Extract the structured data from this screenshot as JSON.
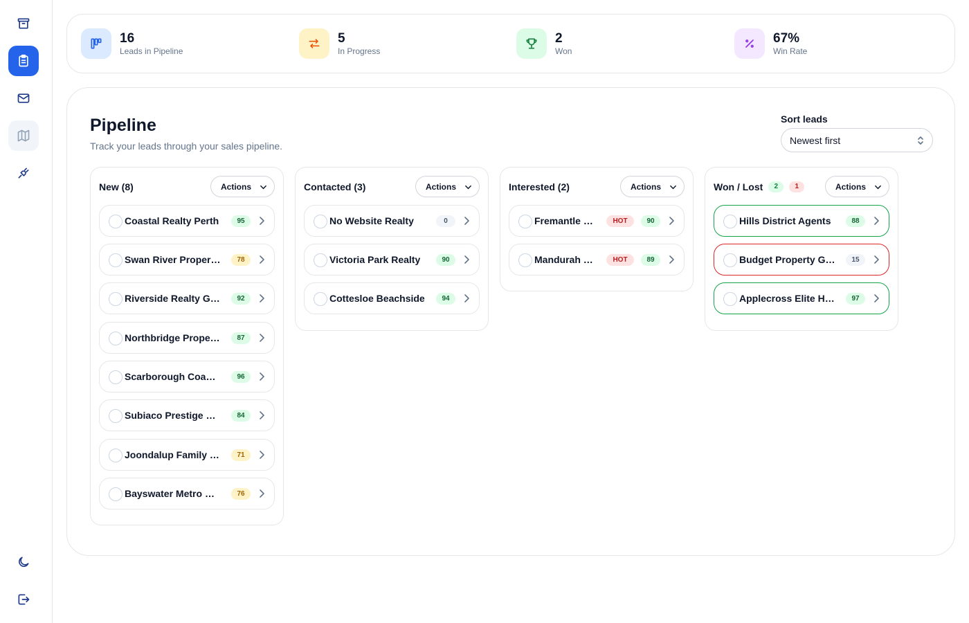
{
  "sidebar": {
    "items": [
      {
        "name": "archive-icon"
      },
      {
        "name": "clipboard-list-icon"
      },
      {
        "name": "mail-icon"
      },
      {
        "name": "map-icon"
      },
      {
        "name": "plug-icon"
      }
    ],
    "bottom": [
      {
        "name": "moon-icon"
      },
      {
        "name": "logout-icon"
      }
    ]
  },
  "stats": [
    {
      "value": "16",
      "label": "Leads in Pipeline",
      "icon": "kanban-icon",
      "bg": "#dbeafe",
      "fg": "#2563eb"
    },
    {
      "value": "5",
      "label": "In Progress",
      "icon": "arrows-swap-icon",
      "bg": "#fef3c7",
      "fg": "#ea580c"
    },
    {
      "value": "2",
      "label": "Won",
      "icon": "trophy-icon",
      "bg": "#dcfce7",
      "fg": "#15803d"
    },
    {
      "value": "67%",
      "label": "Win Rate",
      "icon": "percent-icon",
      "bg": "#f3e8ff",
      "fg": "#9333ea"
    }
  ],
  "pipeline": {
    "title": "Pipeline",
    "subtitle": "Track your leads through your sales pipeline.",
    "sort_label": "Sort leads",
    "sort_value": "Newest first"
  },
  "columns": [
    {
      "title": "New (8)",
      "actions_label": "Actions",
      "leads": [
        {
          "name": "Coastal Realty Perth",
          "score": "95",
          "level": "high"
        },
        {
          "name": "Swan River Properties",
          "score": "78",
          "level": "mid"
        },
        {
          "name": "Riverside Realty Group",
          "score": "92",
          "level": "high"
        },
        {
          "name": "Northbridge Properties",
          "score": "87",
          "level": "high"
        },
        {
          "name": "Scarborough Coastal",
          "score": "96",
          "level": "high"
        },
        {
          "name": "Subiaco Prestige Homes",
          "score": "84",
          "level": "high"
        },
        {
          "name": "Joondalup Family Realty",
          "score": "71",
          "level": "mid"
        },
        {
          "name": "Bayswater Metro Realty",
          "score": "76",
          "level": "mid"
        }
      ]
    },
    {
      "title": "Contacted (3)",
      "actions_label": "Actions",
      "leads": [
        {
          "name": "No Website Realty",
          "score": "0",
          "level": "zero"
        },
        {
          "name": "Victoria Park Realty",
          "score": "90",
          "level": "high"
        },
        {
          "name": "Cottesloe Beachside",
          "score": "94",
          "level": "high"
        }
      ]
    },
    {
      "title": "Interested (2)",
      "actions_label": "Actions",
      "leads": [
        {
          "name": "Fremantle Realty",
          "score": "90",
          "level": "high",
          "hot": "HOT"
        },
        {
          "name": "Mandurah Realty",
          "score": "89",
          "level": "high",
          "hot": "HOT"
        }
      ]
    },
    {
      "title": "Won / Lost",
      "won_count": "2",
      "lost_count": "1",
      "actions_label": "Actions",
      "leads": [
        {
          "name": "Hills District Agents",
          "score": "88",
          "level": "high",
          "status": "won"
        },
        {
          "name": "Budget Property Group",
          "score": "15",
          "level": "zero",
          "status": "lost"
        },
        {
          "name": "Applecross Elite Homes",
          "score": "97",
          "level": "high",
          "status": "won"
        }
      ]
    }
  ]
}
